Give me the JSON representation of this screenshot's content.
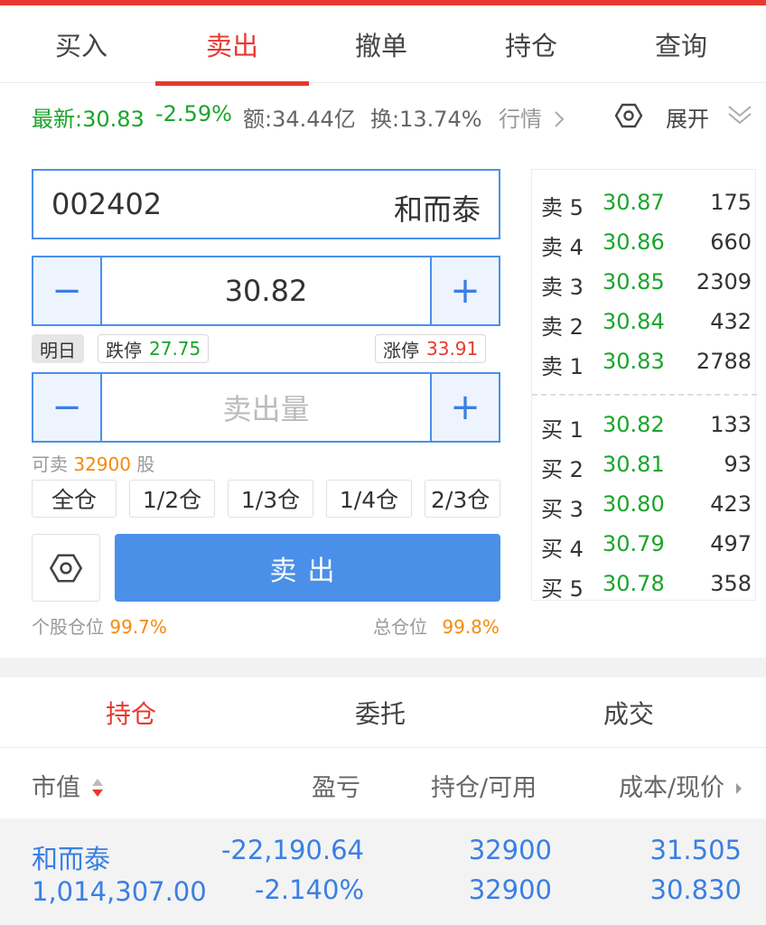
{
  "colors": {
    "accent": "#e8382f",
    "rise": "#e8382f",
    "fall": "#1aa52a",
    "primary": "#4a90e8",
    "highlight": "#f58a0c"
  },
  "tabs": [
    {
      "label": "买入"
    },
    {
      "label": "卖出",
      "active": true
    },
    {
      "label": "撤单"
    },
    {
      "label": "持仓"
    },
    {
      "label": "查询"
    }
  ],
  "quote": {
    "latest": "最新:30.83",
    "change": "-2.59%",
    "amount": "额:34.44亿",
    "turnover": "换:13.74%",
    "market_link": "行情",
    "expand_label": "展开",
    "icons": [
      "chevron-right-icon",
      "hexagon-settings-icon",
      "double-chevron-down-icon"
    ]
  },
  "stock": {
    "code": "002402",
    "name": "和而泰"
  },
  "price_input": {
    "value": "30.82",
    "minus": "−",
    "plus": "+"
  },
  "limits": {
    "day_tag": "明日",
    "down_label": "跌停",
    "down_value": "27.75",
    "up_label": "涨停",
    "up_value": "33.91"
  },
  "qty_input": {
    "placeholder": "卖出量",
    "minus": "−",
    "plus": "+"
  },
  "available": {
    "prefix": "可卖",
    "value": "32900",
    "suffix": "股"
  },
  "ratios": [
    "全仓",
    "1/2仓",
    "1/3仓",
    "1/4仓",
    "2/3仓"
  ],
  "sell_button": "卖出",
  "positions": {
    "stock_label": "个股仓位",
    "stock_value": "99.7%",
    "total_label": "总仓位",
    "total_value": "99.8%"
  },
  "order_book": {
    "asks": [
      {
        "label": "卖 5",
        "price": "30.87",
        "volume": "175"
      },
      {
        "label": "卖 4",
        "price": "30.86",
        "volume": "660"
      },
      {
        "label": "卖 3",
        "price": "30.85",
        "volume": "2309"
      },
      {
        "label": "卖 2",
        "price": "30.84",
        "volume": "432"
      },
      {
        "label": "卖 1",
        "price": "30.83",
        "volume": "2788"
      }
    ],
    "bids": [
      {
        "label": "买 1",
        "price": "30.82",
        "volume": "133"
      },
      {
        "label": "买 2",
        "price": "30.81",
        "volume": "93"
      },
      {
        "label": "买 3",
        "price": "30.80",
        "volume": "423"
      },
      {
        "label": "买 4",
        "price": "30.79",
        "volume": "497"
      },
      {
        "label": "买 5",
        "price": "30.78",
        "volume": "358"
      }
    ]
  },
  "subtabs": [
    {
      "label": "持仓",
      "active": true
    },
    {
      "label": "委托"
    },
    {
      "label": "成交"
    }
  ],
  "table": {
    "headers": [
      "市值",
      "盈亏",
      "持仓/可用",
      "成本/现价"
    ],
    "rows": [
      {
        "name": "和而泰",
        "market_value": "1,014,307.00",
        "pnl": "-22,190.64",
        "pnl_pct": "-2.140%",
        "holding": "32900",
        "available": "32900",
        "cost": "31.505",
        "price": "30.830"
      }
    ]
  }
}
